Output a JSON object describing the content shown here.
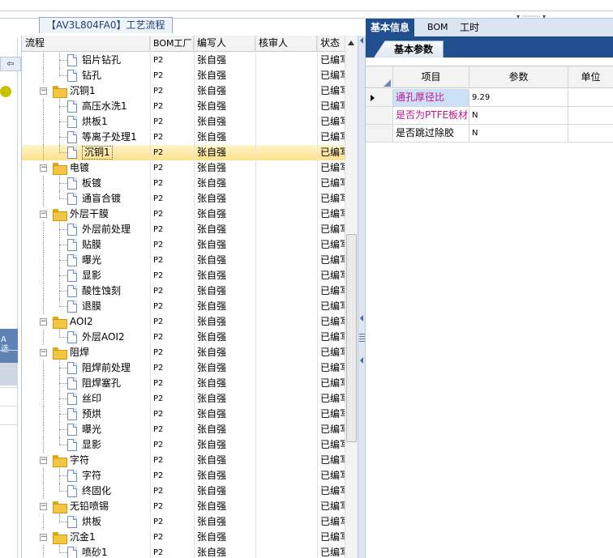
{
  "document_tab": {
    "title": "【AV3L804FA0】工艺流程"
  },
  "left_strip": {
    "blue_label": "A\n选"
  },
  "tree": {
    "columns": [
      "流程",
      "BOM工厂",
      "编写人",
      "核审人",
      "状态"
    ],
    "rows": [
      {
        "label": "铝片钻孔",
        "depth": 1,
        "type": "leaf",
        "bom": "P2",
        "writer": "张自强",
        "reviewer": "",
        "status": "已编写"
      },
      {
        "label": "钻孔",
        "depth": 1,
        "type": "leaf",
        "bom": "P2",
        "writer": "张自强",
        "reviewer": "",
        "status": "已编写"
      },
      {
        "label": "沉铜1",
        "depth": 0,
        "type": "group",
        "bom": "P2",
        "writer": "张自强",
        "reviewer": "",
        "status": "已编写"
      },
      {
        "label": "高压水洗1",
        "depth": 1,
        "type": "leaf",
        "bom": "P2",
        "writer": "张自强",
        "reviewer": "",
        "status": "已编写"
      },
      {
        "label": "烘板1",
        "depth": 1,
        "type": "leaf",
        "bom": "P2",
        "writer": "张自强",
        "reviewer": "",
        "status": "已编写"
      },
      {
        "label": "等离子处理1",
        "depth": 1,
        "type": "leaf",
        "bom": "P2",
        "writer": "张自强",
        "reviewer": "",
        "status": "已编写"
      },
      {
        "label": "沉铜1",
        "depth": 1,
        "type": "leaf",
        "bom": "P2",
        "writer": "张自强",
        "reviewer": "",
        "status": "已编写",
        "selected": true
      },
      {
        "label": "电镀",
        "depth": 0,
        "type": "group",
        "bom": "P2",
        "writer": "张自强",
        "reviewer": "",
        "status": "已编写"
      },
      {
        "label": "板镀",
        "depth": 1,
        "type": "leaf",
        "bom": "P2",
        "writer": "张自强",
        "reviewer": "",
        "status": "已编写"
      },
      {
        "label": "通盲合镀",
        "depth": 1,
        "type": "leaf",
        "bom": "P2",
        "writer": "张自强",
        "reviewer": "",
        "status": "已编写"
      },
      {
        "label": "外层干膜",
        "depth": 0,
        "type": "group",
        "bom": "P2",
        "writer": "张自强",
        "reviewer": "",
        "status": "已编写"
      },
      {
        "label": "外层前处理",
        "depth": 1,
        "type": "leaf",
        "bom": "P2",
        "writer": "张自强",
        "reviewer": "",
        "status": "已编写"
      },
      {
        "label": "贴膜",
        "depth": 1,
        "type": "leaf",
        "bom": "P2",
        "writer": "张自强",
        "reviewer": "",
        "status": "已编写"
      },
      {
        "label": "曝光",
        "depth": 1,
        "type": "leaf",
        "bom": "P2",
        "writer": "张自强",
        "reviewer": "",
        "status": "已编写"
      },
      {
        "label": "显影",
        "depth": 1,
        "type": "leaf",
        "bom": "P2",
        "writer": "张自强",
        "reviewer": "",
        "status": "已编写"
      },
      {
        "label": "酸性蚀刻",
        "depth": 1,
        "type": "leaf",
        "bom": "P2",
        "writer": "张自强",
        "reviewer": "",
        "status": "已编写"
      },
      {
        "label": "退膜",
        "depth": 1,
        "type": "leaf",
        "bom": "P2",
        "writer": "张自强",
        "reviewer": "",
        "status": "已编写"
      },
      {
        "label": "AOI2",
        "depth": 0,
        "type": "group",
        "bom": "P2",
        "writer": "张自强",
        "reviewer": "",
        "status": "已编写"
      },
      {
        "label": "外层AOI2",
        "depth": 1,
        "type": "leaf",
        "bom": "P2",
        "writer": "张自强",
        "reviewer": "",
        "status": "已编写"
      },
      {
        "label": "阻焊",
        "depth": 0,
        "type": "group",
        "bom": "P2",
        "writer": "张自强",
        "reviewer": "",
        "status": "已编写"
      },
      {
        "label": "阻焊前处理",
        "depth": 1,
        "type": "leaf",
        "bom": "P2",
        "writer": "张自强",
        "reviewer": "",
        "status": "已编写"
      },
      {
        "label": "阻焊塞孔",
        "depth": 1,
        "type": "leaf",
        "bom": "P2",
        "writer": "张自强",
        "reviewer": "",
        "status": "已编写"
      },
      {
        "label": "丝印",
        "depth": 1,
        "type": "leaf",
        "bom": "P2",
        "writer": "张自强",
        "reviewer": "",
        "status": "已编写"
      },
      {
        "label": "预烘",
        "depth": 1,
        "type": "leaf",
        "bom": "P2",
        "writer": "张自强",
        "reviewer": "",
        "status": "已编写"
      },
      {
        "label": "曝光",
        "depth": 1,
        "type": "leaf",
        "bom": "P2",
        "writer": "张自强",
        "reviewer": "",
        "status": "已编写"
      },
      {
        "label": "显影",
        "depth": 1,
        "type": "leaf",
        "bom": "P2",
        "writer": "张自强",
        "reviewer": "",
        "status": "已编写"
      },
      {
        "label": "字符",
        "depth": 0,
        "type": "group",
        "bom": "P2",
        "writer": "张自强",
        "reviewer": "",
        "status": "已编写"
      },
      {
        "label": "字符",
        "depth": 1,
        "type": "leaf",
        "bom": "P2",
        "writer": "张自强",
        "reviewer": "",
        "status": "已编写"
      },
      {
        "label": "终固化",
        "depth": 1,
        "type": "leaf",
        "bom": "P2",
        "writer": "张自强",
        "reviewer": "",
        "status": "已编写"
      },
      {
        "label": "无铅喷锡",
        "depth": 0,
        "type": "group",
        "bom": "P2",
        "writer": "张自强",
        "reviewer": "",
        "status": "已编写"
      },
      {
        "label": "烘板",
        "depth": 1,
        "type": "leaf",
        "bom": "P2",
        "writer": "张自强",
        "reviewer": "",
        "status": "已编写"
      },
      {
        "label": "沉金1",
        "depth": 0,
        "type": "group",
        "bom": "P2",
        "writer": "张自强",
        "reviewer": "",
        "status": "已编写"
      },
      {
        "label": "喷砂1",
        "depth": 1,
        "type": "leaf",
        "bom": "P2",
        "writer": "张自强",
        "reviewer": "",
        "status": "已编写"
      }
    ]
  },
  "right_panel": {
    "tabs": [
      {
        "label": "基本信息",
        "active": true
      },
      {
        "label": "BOM",
        "active": false
      },
      {
        "label": "工时",
        "active": false
      }
    ],
    "subtab": "基本参数",
    "param_columns": [
      "项目",
      "参数",
      "单位"
    ],
    "params": [
      {
        "name": "通孔厚径比",
        "value": "9.29",
        "unit": "",
        "name_color": "#c0178c",
        "current": true
      },
      {
        "name": "是否为PTFE板材",
        "value": "N",
        "unit": "",
        "name_color": "#c0178c",
        "current": false
      },
      {
        "name": "是否跳过除胶",
        "value": "N",
        "unit": "",
        "name_color": "#000000",
        "current": false
      }
    ]
  },
  "colors": {
    "accent": "#1f4f8e",
    "selection": "#ffe08a",
    "highlight_text": "#c0178c"
  }
}
